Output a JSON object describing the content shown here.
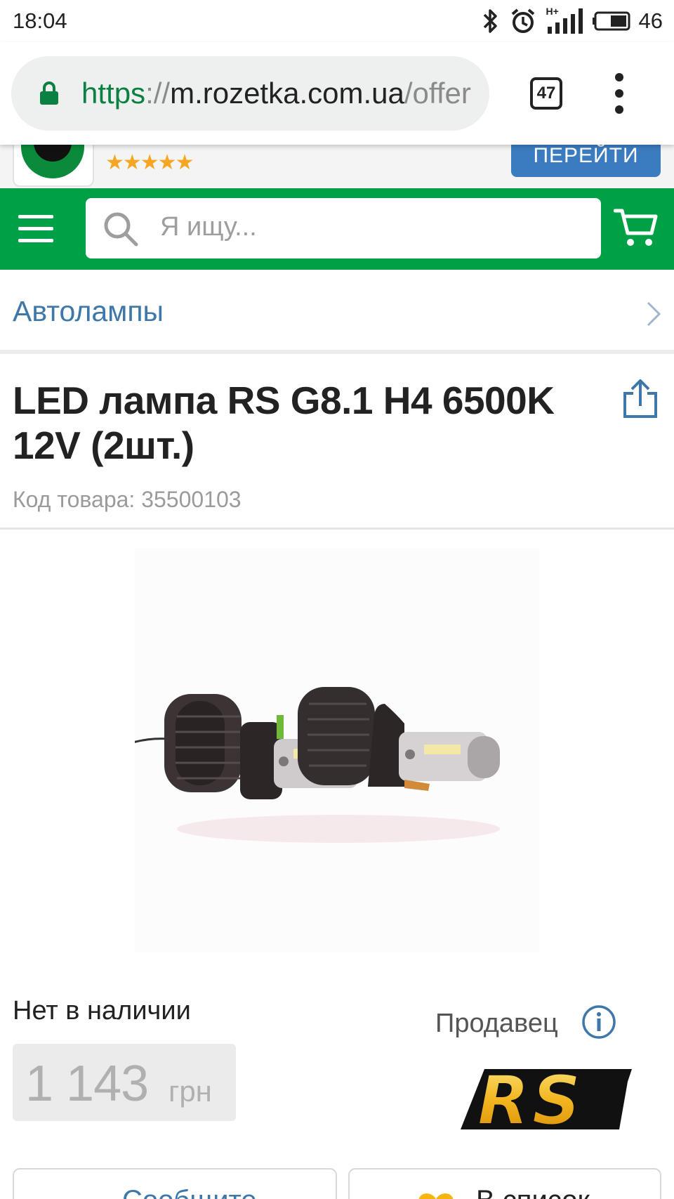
{
  "status_bar": {
    "time": "18:04",
    "network_label": "H+",
    "battery_level": "46"
  },
  "browser": {
    "url_scheme": "https",
    "url_separator": "://",
    "url_host": "m.rozetka.com.ua",
    "url_path": "/offer",
    "tab_count": "47"
  },
  "promo_banner": {
    "stars": "★★★★★",
    "rating": 4.5,
    "button_label": "ПЕРЕЙТИ"
  },
  "header": {
    "search_placeholder": "Я ищу..."
  },
  "breadcrumb": {
    "label": "Автолампы"
  },
  "product": {
    "title": "LED лампа RS G8.1 H4 6500K 12V (2шт.)",
    "code": "Код товара: 35500103",
    "availability": "Нет в наличии",
    "price_value": "1 143",
    "price_currency": "грн",
    "seller_label": "Продавец",
    "seller_logo_text": "RS"
  },
  "actions": {
    "notify_label": "Сообщите",
    "wishlist_label": "В список"
  },
  "colors": {
    "brand_green": "#00a046",
    "link_blue": "#3e77aa",
    "promo_button_blue": "#3a7cbf",
    "star_orange": "#f5a623"
  }
}
